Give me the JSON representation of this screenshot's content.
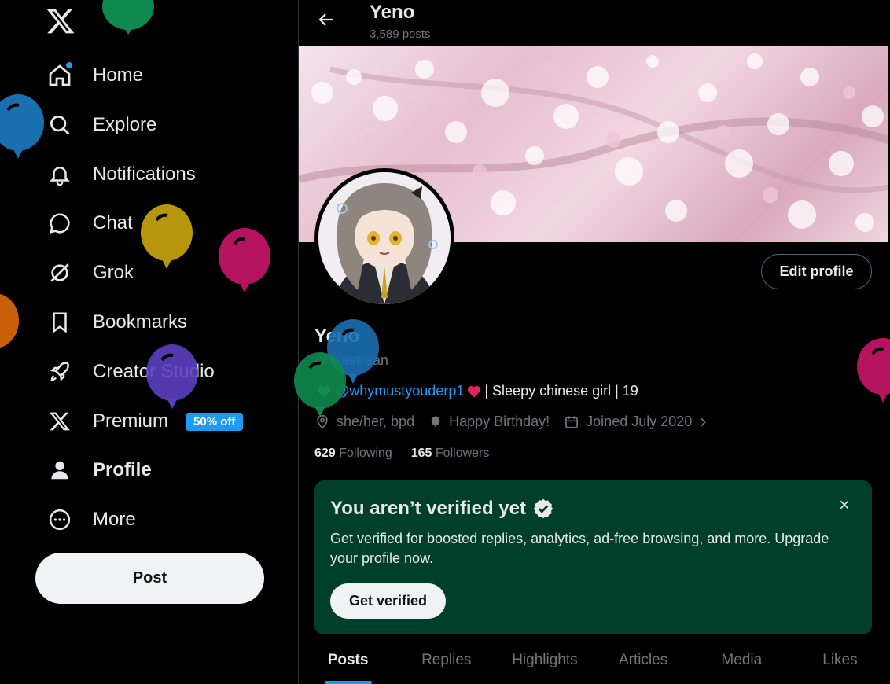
{
  "nav": {
    "logo_icon": "x-logo-icon",
    "items": [
      {
        "label": "Home",
        "icon": "home-icon"
      },
      {
        "label": "Explore",
        "icon": "search-icon"
      },
      {
        "label": "Notifications",
        "icon": "bell-icon"
      },
      {
        "label": "Chat",
        "icon": "chat-bubble-icon"
      },
      {
        "label": "Grok",
        "icon": "grok-icon"
      },
      {
        "label": "Bookmarks",
        "icon": "bookmark-icon"
      },
      {
        "label": "Creator Studio",
        "icon": "rocket-icon"
      },
      {
        "label": "Premium",
        "icon": "x-logo-icon",
        "badge": "50% off"
      },
      {
        "label": "Profile",
        "icon": "person-icon"
      },
      {
        "label": "More",
        "icon": "more-circle-icon"
      }
    ],
    "post_label": "Post"
  },
  "header": {
    "name": "Yeno",
    "posts_count": "3,589 posts"
  },
  "profile": {
    "name": "Yeno",
    "handle": "@Viastrean",
    "bio_mention": "@whymustyouderp1",
    "bio_text": "| Sleepy chinese girl | 19",
    "pronouns": "she/her, bpd",
    "birthday": "Happy Birthday!",
    "joined": "Joined July 2020",
    "following_count": "629",
    "following_label": "Following",
    "followers_count": "165",
    "followers_label": "Followers",
    "edit_label": "Edit profile"
  },
  "verify_card": {
    "title": "You aren’t verified yet",
    "text": "Get verified for boosted replies, analytics, ad-free browsing, and more. Upgrade your profile now.",
    "button": "Get verified"
  },
  "tabs": [
    "Posts",
    "Replies",
    "Highlights",
    "Articles",
    "Media",
    "Likes"
  ],
  "colors": {
    "accent": "#1d9bf0",
    "verify_bg": "#00402a",
    "balloon_green": "#0f8a4f",
    "balloon_blue": "#1a6fb0",
    "balloon_yellow": "#b8960c",
    "balloon_magenta": "#b5135f",
    "balloon_orange": "#c8600a",
    "balloon_purple": "#5b3fc0"
  }
}
